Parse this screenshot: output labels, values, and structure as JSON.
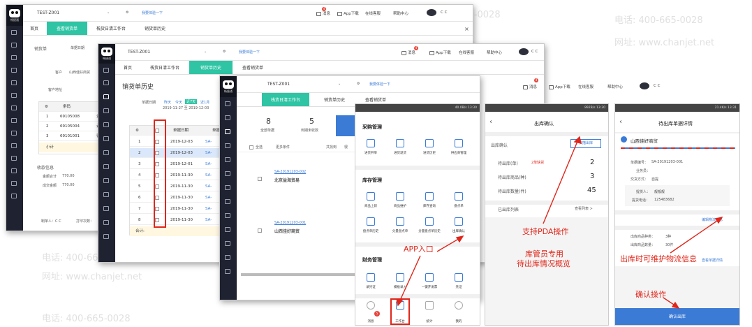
{
  "watermark": {
    "phone": "电话: 400-665-0028",
    "site": "网址: www.chanjet.net"
  },
  "common": {
    "org": "TEST-Z001",
    "hint": "我要体验一下",
    "msg": "消息",
    "app": "App下载",
    "service": "在线客服",
    "help": "帮助中心",
    "user": "C C",
    "logo": "畅捷通",
    "badge": "4",
    "close": "×"
  },
  "win1": {
    "tabs": [
      "首页",
      "查看销货单",
      "栈货日清工作台",
      "销货单历史"
    ],
    "doc": "销货单",
    "date_label": "单据日期",
    "cust_label": "客户",
    "cust_value": "山西佳好商贸",
    "addr_label": "客户地址",
    "col_code": "条码",
    "rows": [
      {
        "n": "1",
        "code": "69105008",
        "x": "云"
      },
      {
        "n": "2",
        "code": "69105004",
        "x": "云"
      },
      {
        "n": "3",
        "code": "69101001",
        "x": "德"
      }
    ],
    "subtotal": "小计",
    "pay_title": "收款信息",
    "total_label": "金额合计",
    "total_val": "770.00",
    "paid_label": "成交金额",
    "paid_val": "770.00",
    "maker": "制单人：C C",
    "print": "打印次数："
  },
  "win2": {
    "tabs": [
      "首页",
      "栈货日清工作台",
      "销货单历史",
      "查看销货单"
    ],
    "title": "销货单历史",
    "date_label": "单据日期",
    "d1": "昨天",
    "d2": "今天",
    "d3": "近7天",
    "d4": "近1月",
    "dr1": "2019-11-27 至 2019-12-03",
    "col_date": "单据日期",
    "col_no": "单据号",
    "rows": [
      {
        "n": "1",
        "d": "2019-12-03",
        "s": "SA-"
      },
      {
        "n": "2",
        "d": "2019-12-03",
        "s": "SA-"
      },
      {
        "n": "3",
        "d": "2019-12-01",
        "s": "SA-"
      },
      {
        "n": "4",
        "d": "2019-11-30",
        "s": "SA-"
      },
      {
        "n": "5",
        "d": "2019-11-30",
        "s": "SA-"
      },
      {
        "n": "6",
        "d": "2019-11-30",
        "s": "SA-"
      },
      {
        "n": "7",
        "d": "2019-11-30",
        "s": "SA-"
      },
      {
        "n": "8",
        "d": "2019-11-30",
        "s": "SA-"
      }
    ],
    "total": "合计:"
  },
  "win3": {
    "tabs": [
      "栈货日清工作台",
      "销货单历史",
      "查看销货单"
    ],
    "s1n": "8",
    "s1l": "全部单据",
    "s2n": "5",
    "s2l": "到期未收款",
    "selall": "全选",
    "more": "更多条件",
    "count": "共找到",
    "tail": "很",
    "i1no": "SA-20191203-002",
    "i1c": "北京益海贸易",
    "i2no": "SA-20191203-001",
    "i2c": "山西佳好商贸"
  },
  "phone1": {
    "status": "40.0B/s 13:30",
    "s_purchase": "采购管理",
    "p": [
      "进货开单",
      "进货退货",
      "进货历史",
      "供应商管理"
    ],
    "s_stock": "库存管理",
    "k1": [
      "商品上新",
      "商品维护",
      "库存查询",
      "盘点单"
    ],
    "k2": [
      "盘点单历史",
      "分量盘点单",
      "分量盘点单历史",
      "出库确认"
    ],
    "s_fin": "财务管理",
    "f": [
      "录凭证",
      "模板录入",
      "一键开发票",
      "凭证"
    ],
    "nav": [
      "消息",
      "工作台",
      "统计",
      "我的"
    ],
    "navbadge": "5"
  },
  "phone2": {
    "status": "892B/s 13:30",
    "title": "出库确认",
    "sub": "出库确认",
    "scan": "扫描出库",
    "r1": "待出库(单)",
    "r1b": "2单缺货",
    "r1v": "2",
    "r2": "待出库商品(种)",
    "r2v": "3",
    "r3": "待出库数量(件)",
    "r3v": "45",
    "r4": "已出库列表",
    "more": "查看列表 >"
  },
  "phone3": {
    "status": "21.4K/s 13:31",
    "title": "待出库单据详情",
    "cust": "山西佳好商贸",
    "no_label": "单据编号：",
    "no": "SA-20191203-001",
    "staff_label": "业务员：",
    "pay_label": "交货方式：",
    "pay": "自提",
    "contact_label": "提货人：",
    "contact": "靓靓靓",
    "phone_label": "提货电话：",
    "phone": "125483682",
    "edit": "编辑物流信息",
    "kinds_label": "出库商品种类：",
    "kinds": "3种",
    "qty_label": "出库商品数量：",
    "qty": "30件",
    "detail": "查看单据详情",
    "confirm": "确认出库"
  },
  "annotations": {
    "app": "APP入口",
    "pda": "支持PDA操作",
    "keeper1": "库管员专用",
    "keeper2": "待出库情况概览",
    "logistics": "出库时可维护物流信息",
    "confirm": "确认操作"
  },
  "colors": {
    "accent": "#2ec4a4",
    "sidebar": "#1f2230",
    "annotation": "#e0261a",
    "primary": "#3b7bd6"
  }
}
